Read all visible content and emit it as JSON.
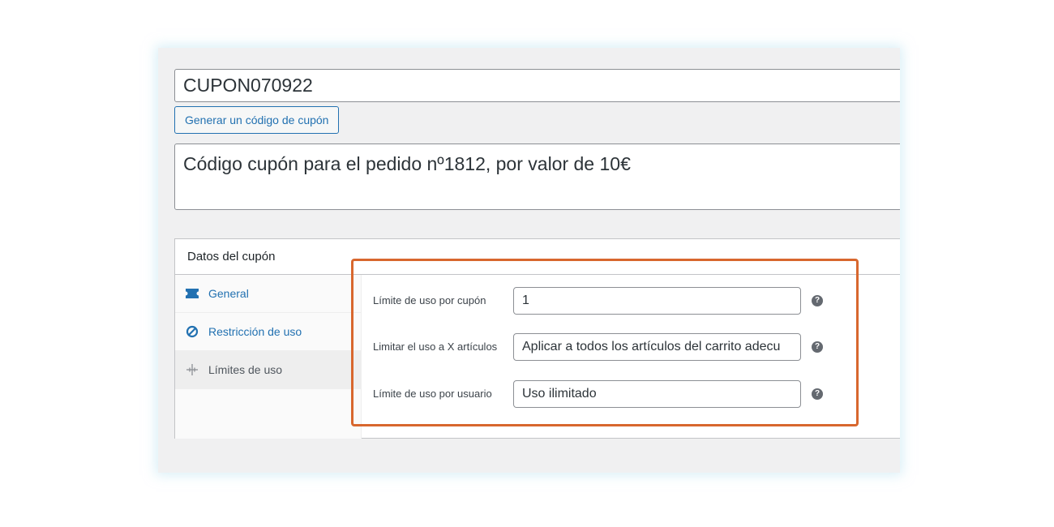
{
  "coupon": {
    "code": "CUPON070922",
    "generate_button": "Generar un código de cupón",
    "description": "Código cupón para el pedido nº1812, por valor de 10€"
  },
  "panel": {
    "title": "Datos del cupón",
    "tabs": [
      {
        "label": "General",
        "icon": "ticket-icon"
      },
      {
        "label": "Restricción de uso",
        "icon": "ban-icon"
      },
      {
        "label": "Límites de uso",
        "icon": "crosshair-icon",
        "active": true
      }
    ],
    "fields": [
      {
        "label": "Límite de uso por cupón",
        "value": "1",
        "help": "?"
      },
      {
        "label": "Limitar el uso a X artículos",
        "placeholder": "Aplicar a todos los artículos del carrito adecu",
        "help": "?"
      },
      {
        "label": "Límite de uso por usuario",
        "placeholder": "Uso ilimitado",
        "help": "?"
      }
    ]
  },
  "colors": {
    "accent": "#2271b1",
    "highlight": "#d8672e"
  }
}
